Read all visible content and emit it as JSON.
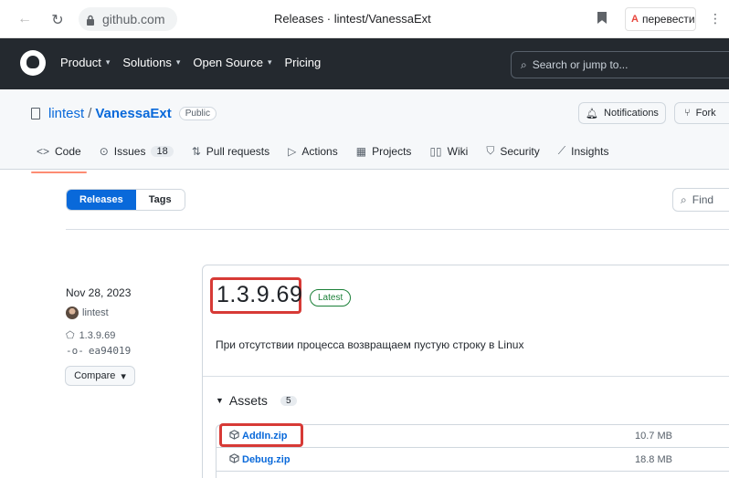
{
  "browser": {
    "url": "github.com",
    "tab_title": "Releases · lintest/VanessaExt",
    "translate_label": "перевести"
  },
  "github_header": {
    "menu": [
      "Product",
      "Solutions",
      "Open Source",
      "Pricing"
    ],
    "search_placeholder": "Search or jump to..."
  },
  "repo": {
    "owner": "lintest",
    "slash": "/",
    "name": "VanessaExt",
    "visibility": "Public",
    "notifications_label": "Notifications",
    "fork_label": "Fork",
    "tabs": [
      {
        "label": "Code",
        "icon": "code-icon"
      },
      {
        "label": "Issues",
        "icon": "issue-icon",
        "count": "18"
      },
      {
        "label": "Pull requests",
        "icon": "pull-request-icon"
      },
      {
        "label": "Actions",
        "icon": "play-icon"
      },
      {
        "label": "Projects",
        "icon": "table-icon"
      },
      {
        "label": "Wiki",
        "icon": "book-icon"
      },
      {
        "label": "Security",
        "icon": "shield-icon"
      },
      {
        "label": "Insights",
        "icon": "graph-icon"
      }
    ]
  },
  "toolbar": {
    "releases_label": "Releases",
    "tags_label": "Tags",
    "find_placeholder": "Find"
  },
  "release": {
    "date": "Nov 28, 2023",
    "author": "lintest",
    "tag": "1.3.9.69",
    "commit": "ea94019",
    "compare_label": "Compare",
    "version": "1.3.9.69",
    "latest_label": "Latest",
    "description": "При отсутствии процесса возвращаем пустую строку в Linux",
    "assets_label": "Assets",
    "assets_count": "5",
    "assets": [
      {
        "name": "AddIn.zip",
        "size": "10.7 MB"
      },
      {
        "name": "Debug.zip",
        "size": "18.8 MB"
      }
    ]
  },
  "colors": {
    "accent": "#0969da",
    "header_bg": "#24292f",
    "highlight": "#d73a36",
    "latest_green": "#1a7f37"
  }
}
